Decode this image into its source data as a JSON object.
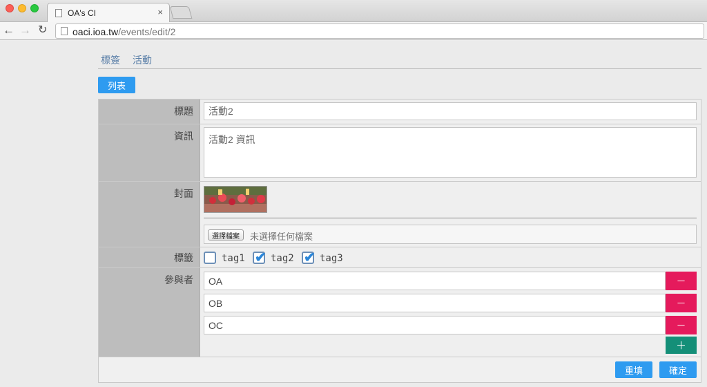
{
  "browser": {
    "tab_title": "OA's CI",
    "tab_close": "×",
    "url_host": "oaci.ioa.tw",
    "url_path": "/events/edit/2",
    "nav": {
      "back": "←",
      "forward": "→",
      "reload": "↻"
    }
  },
  "topnav": {
    "tags": "標簽",
    "events": "活動"
  },
  "list_button": "列表",
  "form": {
    "title": {
      "label": "標題",
      "value": "活動2"
    },
    "info": {
      "label": "資訊",
      "value": "活動2 資訊"
    },
    "cover": {
      "label": "封面",
      "file_button": "選擇檔案",
      "file_status": "未選擇任何檔案"
    },
    "tags": {
      "label": "標籤",
      "items": [
        {
          "name": "tag1",
          "checked": false
        },
        {
          "name": "tag2",
          "checked": true
        },
        {
          "name": "tag3",
          "checked": true
        }
      ]
    },
    "participants": {
      "label": "參與者",
      "items": [
        "OA",
        "OB",
        "OC"
      ],
      "remove_label": "－",
      "add_label": "＋"
    },
    "reset_button": "重填",
    "submit_button": "確定"
  },
  "colors": {
    "primary": "#2e9bf0",
    "danger": "#e51a5c",
    "success": "#148f78",
    "link": "#5a7fa8"
  }
}
